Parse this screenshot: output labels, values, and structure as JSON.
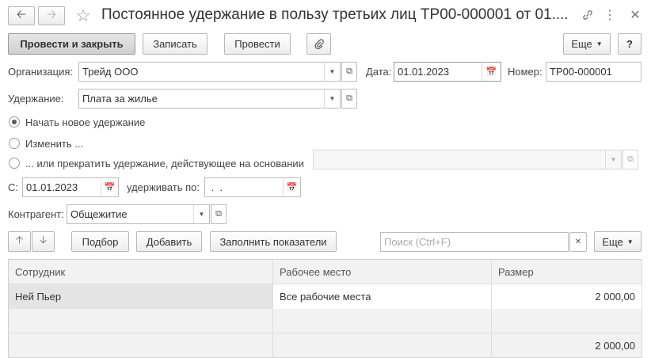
{
  "window": {
    "title": "Постоянное удержание в пользу третьих лиц ТР00-000001 от 01...."
  },
  "toolbar": {
    "post_close": "Провести и закрыть",
    "save": "Записать",
    "post": "Провести",
    "more": "Еще",
    "help": "?"
  },
  "form": {
    "organization_label": "Организация:",
    "organization_value": "Трейд ООО",
    "date_label": "Дата:",
    "date_value": "01.01.2023",
    "number_label": "Номер:",
    "number_value": "ТР00-000001",
    "deduction_label": "Удержание:",
    "deduction_value": "Плата за жилье",
    "radio_new": "Начать новое удержание",
    "radio_change": "Изменить ...",
    "radio_stop": "... или прекратить удержание, действующее на основании",
    "from_label": "С:",
    "from_value": "01.01.2023",
    "hold_until_label": "удерживать по:",
    "hold_until_value": " .  .",
    "counterparty_label": "Контрагент:",
    "counterparty_value": "Общежитие"
  },
  "table_toolbar": {
    "pick": "Подбор",
    "add": "Добавить",
    "fill": "Заполнить показатели",
    "search_placeholder": "Поиск (Ctrl+F)",
    "more": "Еще"
  },
  "table": {
    "headers": [
      "Сотрудник",
      "Рабочее место",
      "Размер"
    ],
    "rows": [
      {
        "employee": "Ней Пьер",
        "workplace": "Все рабочие места",
        "amount": "2 000,00"
      }
    ],
    "total": "2 000,00"
  }
}
